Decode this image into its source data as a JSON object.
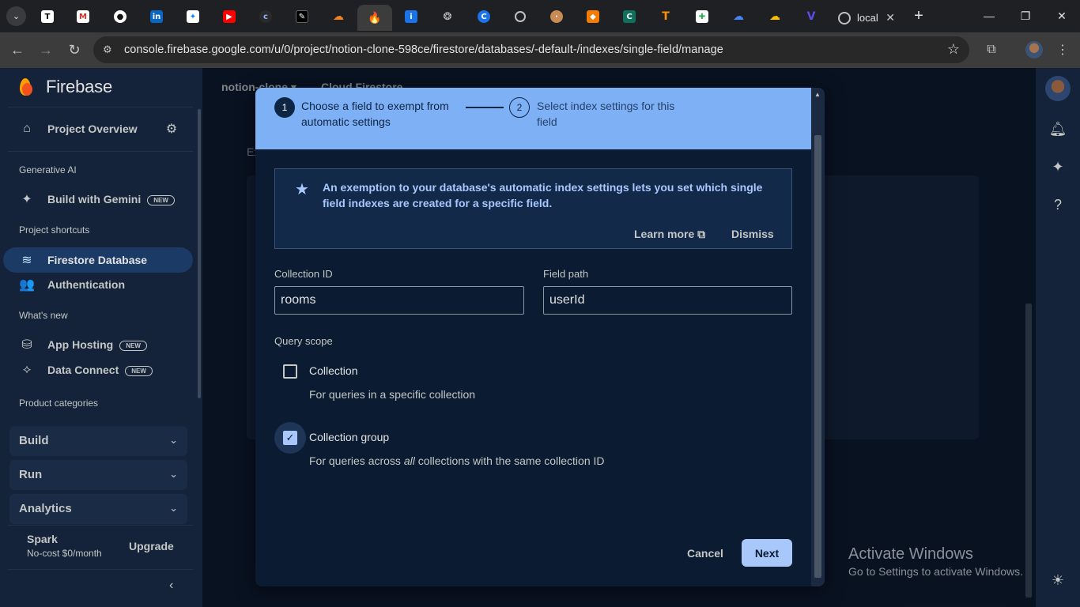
{
  "browser": {
    "tab_title": "local",
    "url": "console.firebase.google.com/u/0/project/notion-clone-598ce/firestore/databases/-default-/indexes/single-field/manage",
    "tab_icons": [
      "notion-T",
      "gmail-M",
      "chat",
      "linkedin-in",
      "bluesky",
      "youtube",
      "c-ring",
      "pen",
      "cloud",
      "firebase-active",
      "info-i",
      "openai",
      "c-blue",
      "globe",
      "cookie",
      "cube",
      "c-green",
      "tensorflow",
      "google-apps",
      "cloud-google",
      "cloud-google-2",
      "v-purple"
    ]
  },
  "sidebar": {
    "brand": "Firebase",
    "project_overview": "Project Overview",
    "section_genai": "Generative AI",
    "build_with_gemini": "Build with Gemini",
    "new_badge": "NEW",
    "section_shortcuts": "Project shortcuts",
    "firestore": "Firestore Database",
    "authentication": "Authentication",
    "section_whatsnew": "What's new",
    "app_hosting": "App Hosting",
    "data_connect": "Data Connect",
    "section_categories": "Product categories",
    "categories": [
      "Build",
      "Run",
      "Analytics"
    ],
    "plan_name": "Spark",
    "plan_desc": "No-cost $0/month",
    "upgrade": "Upgrade"
  },
  "main": {
    "project": "notion-clone",
    "product": "Cloud Firestore",
    "bg_text": "Ex"
  },
  "dialog": {
    "step1_number": "1",
    "step1_label": "Choose a field to exempt from automatic settings",
    "step2_number": "2",
    "step2_label": "Select index settings for this field",
    "info_text": "An exemption to your database's automatic index settings lets you set which single field indexes are created for a specific field.",
    "learn_more": "Learn more",
    "dismiss": "Dismiss",
    "collection_id_label": "Collection ID",
    "collection_id_value": "rooms",
    "field_path_label": "Field path",
    "field_path_value": "userId",
    "query_scope_label": "Query scope",
    "opt1_title": "Collection",
    "opt1_desc": "For queries in a specific collection",
    "opt1_checked": false,
    "opt2_title": "Collection group",
    "opt2_desc_pre": "For queries across ",
    "opt2_desc_em": "all",
    "opt2_desc_post": " collections with the same collection ID",
    "opt2_checked": true,
    "cancel": "Cancel",
    "next": "Next"
  },
  "watermark": {
    "line1": "Activate Windows",
    "line2": "Go to Settings to activate Windows."
  }
}
